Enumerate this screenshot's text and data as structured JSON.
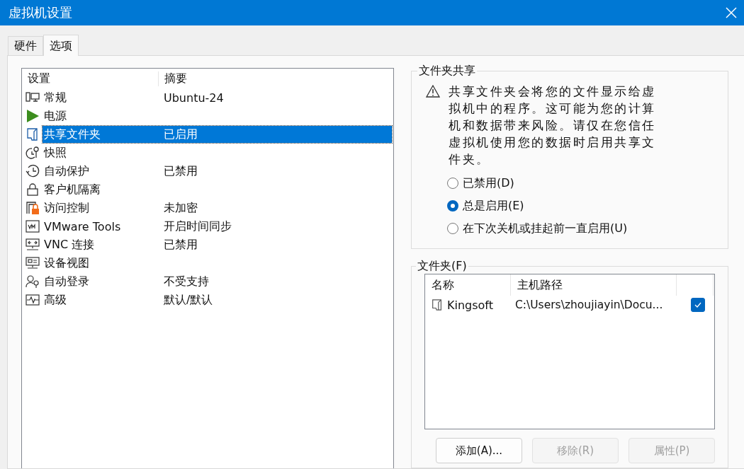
{
  "window": {
    "title": "虚拟机设置"
  },
  "tabs": [
    {
      "label": "硬件",
      "selected": false
    },
    {
      "label": "选项",
      "selected": true
    }
  ],
  "settings_list": {
    "columns": [
      "设置",
      "摘要"
    ],
    "items": [
      {
        "name": "常规",
        "summary": "Ubuntu-24",
        "selected": false
      },
      {
        "name": "电源",
        "selected": false
      },
      {
        "name": "共享文件夹",
        "summary": "已启用",
        "selected": true
      },
      {
        "name": "快照",
        "selected": false
      },
      {
        "name": "自动保护",
        "summary": "已禁用",
        "selected": false
      },
      {
        "name": "客户机隔离",
        "selected": false
      },
      {
        "name": "访问控制",
        "summary": "未加密",
        "selected": false
      },
      {
        "name": "VMware Tools",
        "summary": "开启时间同步",
        "selected": false
      },
      {
        "name": "VNC 连接",
        "summary": "已禁用",
        "selected": false
      },
      {
        "name": "设备视图",
        "selected": false
      },
      {
        "name": "自动登录",
        "summary": "不受支持",
        "selected": false
      },
      {
        "name": "高级",
        "summary": "默认/默认",
        "selected": false
      }
    ]
  },
  "folder_sharing": {
    "title": "文件夹共享",
    "warning": "共享文件夹会将您的文件显示给虚拟机中的程序。这可能为您的计算机和数据带来风险。请仅在您信任虚拟机使用您的数据时启用共享文件夹。",
    "options": [
      {
        "label": "已禁用(D)",
        "selected": false
      },
      {
        "label": "总是启用(E)",
        "selected": true
      },
      {
        "label": "在下次关机或挂起前一直启用(U)",
        "selected": false
      }
    ]
  },
  "folders": {
    "title": "文件夹(F)",
    "columns": [
      "名称",
      "主机路径"
    ],
    "rows": [
      {
        "name": "Kingsoft",
        "path": "C:\\Users\\zhoujiayin\\Docu...",
        "checked": true
      }
    ],
    "buttons": [
      {
        "label": "添加(A)...",
        "disabled": false
      },
      {
        "label": "移除(R)",
        "disabled": true
      },
      {
        "label": "属性(P)",
        "disabled": true
      }
    ]
  }
}
